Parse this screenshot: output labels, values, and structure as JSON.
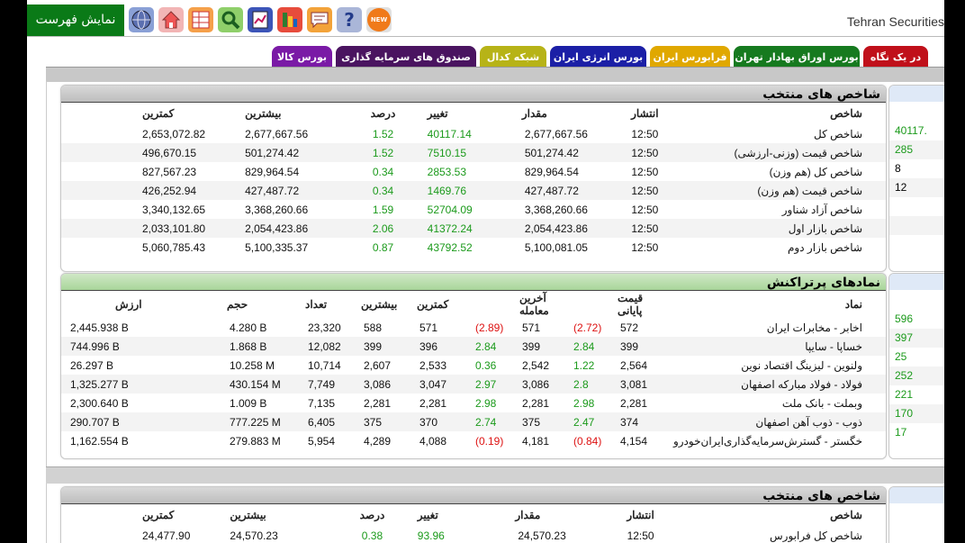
{
  "header": {
    "menu_label": "نمایش فهرست",
    "site_title": "Tehran Securities",
    "new_badge": "NEW",
    "help_glyph": "?"
  },
  "icons": [
    "globe-icon",
    "home-icon",
    "table-icon",
    "search-icon",
    "book-icon",
    "chart-icon",
    "chat-icon",
    "help-icon",
    "new-icon"
  ],
  "tabs": [
    {
      "label": "در یک نگاه",
      "color": "#c0101a"
    },
    {
      "label": "بورس اوراق بهادار تهران",
      "color": "#167a1f"
    },
    {
      "label": "فرابورس ایران",
      "color": "#e0a800"
    },
    {
      "label": "بورس انرژی ایران",
      "color": "#1b1fa6"
    },
    {
      "label": "شبکه کدال",
      "color": "#b7b317"
    },
    {
      "label": "صندوق های سرمایه گذاری",
      "color": "#4a1460"
    },
    {
      "label": "بورس کالا",
      "color": "#7a1aa6"
    }
  ],
  "indices_panel": {
    "title": "شاخص های منتخب",
    "columns": [
      "شاخص",
      "انتشار",
      "مقدار",
      "تغییر",
      "درصد",
      "بیشترین",
      "کمترین"
    ],
    "rows": [
      {
        "name": "شاخص کل",
        "time": "12:50",
        "value": "2,677,667.56",
        "change": "40117.14",
        "pct": "1.52",
        "high": "2,677,667.56",
        "low": "2,653,072.82"
      },
      {
        "name": "شاخص قیمت (وزنی-ارزشی)",
        "time": "12:50",
        "value": "501,274.42",
        "change": "7510.15",
        "pct": "1.52",
        "high": "501,274.42",
        "low": "496,670.15"
      },
      {
        "name": "شاخص کل (هم وزن)",
        "time": "12:50",
        "value": "829,964.54",
        "change": "2853.53",
        "pct": "0.34",
        "high": "829,964.54",
        "low": "827,567.23"
      },
      {
        "name": "شاخص قیمت (هم وزن)",
        "time": "12:50",
        "value": "427,487.72",
        "change": "1469.76",
        "pct": "0.34",
        "high": "427,487.72",
        "low": "426,252.94"
      },
      {
        "name": "شاخص آزاد شناور",
        "time": "12:50",
        "value": "3,368,260.66",
        "change": "52704.09",
        "pct": "1.59",
        "high": "3,368,260.66",
        "low": "3,340,132.65"
      },
      {
        "name": "شاخص بازار اول",
        "time": "12:50",
        "value": "2,054,423.86",
        "change": "41372.24",
        "pct": "2.06",
        "high": "2,054,423.86",
        "low": "2,033,101.80"
      },
      {
        "name": "شاخص بازار دوم",
        "time": "12:50",
        "value": "5,100,081.05",
        "change": "43792.52",
        "pct": "0.87",
        "high": "5,100,335.37",
        "low": "5,060,785.43"
      }
    ]
  },
  "right_stub_top": {
    "values": [
      "40117.",
      "285",
      "8",
      "12",
      "",
      "",
      ""
    ]
  },
  "symbols_panel": {
    "title": "نمادهای پرتراکنش",
    "columns": [
      "نماد",
      "قیمت پایانی",
      "",
      "آخرین معامله",
      "",
      "کمترین",
      "بیشترین",
      "تعداد",
      "حجم",
      "ارزش"
    ],
    "rows": [
      {
        "name": "اخابر - مخابرات ایران",
        "close": "572",
        "close_chg": "(2.72)",
        "close_neg": true,
        "last": "571",
        "last_chg": "(2.89)",
        "last_neg": true,
        "low": "571",
        "high": "588",
        "count": "23,320",
        "volume": "4.280 B",
        "value": "2,445.938 B"
      },
      {
        "name": "خساپا - سایپا",
        "close": "399",
        "close_chg": "2.84",
        "close_neg": false,
        "last": "399",
        "last_chg": "2.84",
        "last_neg": false,
        "low": "396",
        "high": "399",
        "count": "12,082",
        "volume": "1.868 B",
        "value": "744.996 B"
      },
      {
        "name": "ولنوین - لیزینگ اقتصاد نوین",
        "close": "2,564",
        "close_chg": "1.22",
        "close_neg": false,
        "last": "2,542",
        "last_chg": "0.36",
        "last_neg": false,
        "low": "2,533",
        "high": "2,607",
        "count": "10,714",
        "volume": "10.258 M",
        "value": "26.297 B"
      },
      {
        "name": "فولاد - فولاد مبارکه اصفهان",
        "close": "3,081",
        "close_chg": "2.8",
        "close_neg": false,
        "last": "3,086",
        "last_chg": "2.97",
        "last_neg": false,
        "low": "3,047",
        "high": "3,086",
        "count": "7,749",
        "volume": "430.154 M",
        "value": "1,325.277 B"
      },
      {
        "name": "وبملت - بانک ملت",
        "close": "2,281",
        "close_chg": "2.98",
        "close_neg": false,
        "last": "2,281",
        "last_chg": "2.98",
        "last_neg": false,
        "low": "2,281",
        "high": "2,281",
        "count": "7,135",
        "volume": "1.009 B",
        "value": "2,300.640 B"
      },
      {
        "name": "ذوب - ذوب آهن اصفهان",
        "close": "374",
        "close_chg": "2.47",
        "close_neg": false,
        "last": "375",
        "last_chg": "2.74",
        "last_neg": false,
        "low": "370",
        "high": "375",
        "count": "6,405",
        "volume": "777.225 M",
        "value": "290.707 B"
      },
      {
        "name": "خگستر - گسترش‌سرمایه‌گذاری‌ایران‌خودرو",
        "close": "4,154",
        "close_chg": "(0.84)",
        "close_neg": true,
        "last": "4,181",
        "last_chg": "(0.19)",
        "last_neg": true,
        "low": "4,088",
        "high": "4,289",
        "count": "5,954",
        "volume": "279.883 M",
        "value": "1,162.554 B"
      }
    ]
  },
  "right_stub_mid": {
    "values": [
      "596",
      "397",
      "25",
      "252",
      "221",
      "170",
      "17"
    ]
  },
  "indices_panel_2": {
    "title": "شاخص های منتخب",
    "columns": [
      "شاخص",
      "انتشار",
      "مقدار",
      "تغییر",
      "درصد",
      "بیشترین",
      "کمترین"
    ],
    "rows": [
      {
        "name": "شاخص کل فرابورس",
        "time": "12:50",
        "value": "24,570.23",
        "change": "93.96",
        "pct": "0.38",
        "high": "24,570.23",
        "low": "24,477.90"
      }
    ]
  }
}
